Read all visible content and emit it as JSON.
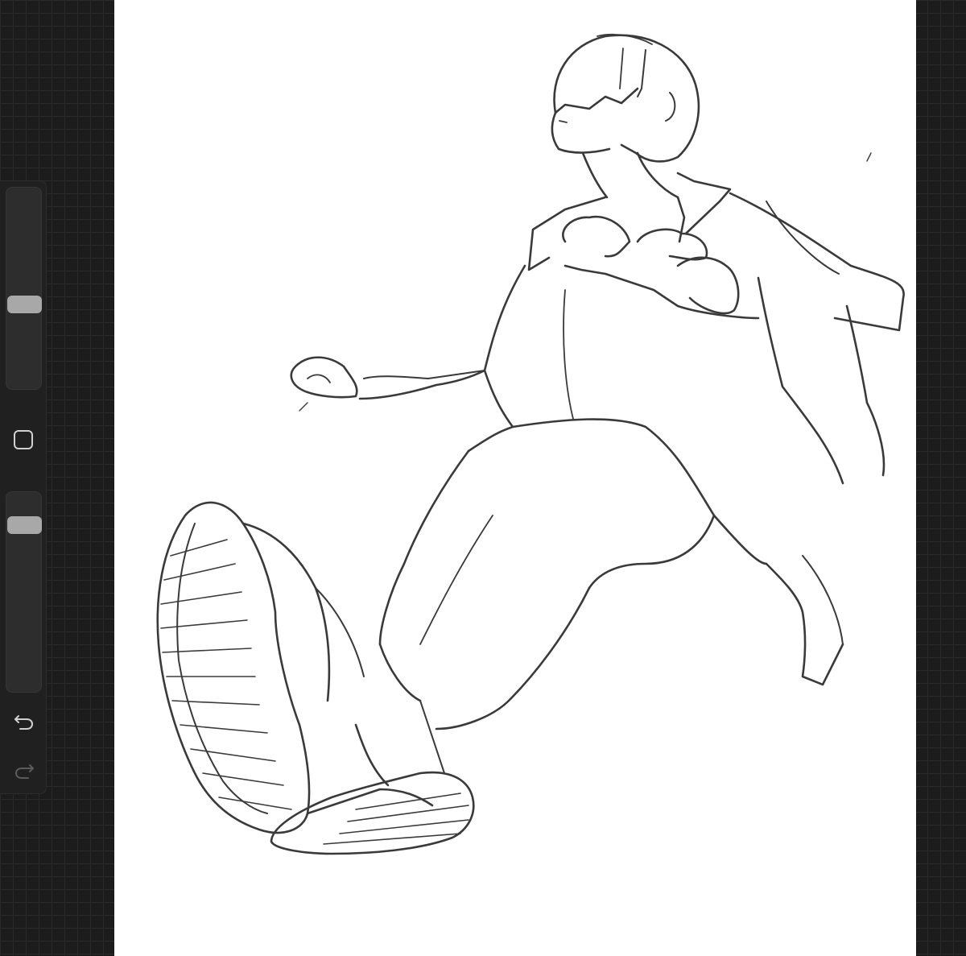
{
  "app": {
    "name": "drawing-canvas"
  },
  "sidebar": {
    "brush_size_slider": {
      "level": 0.41
    },
    "opacity_slider": {
      "level": 0.87
    },
    "modify_button_icon": "square-outline-icon",
    "undo_icon": "undo-arrow-icon",
    "redo_icon": "redo-arrow-icon",
    "redo_enabled": false
  },
  "canvas": {
    "background": "#ffffff",
    "stroke_color": "#3a3a3a"
  },
  "colors": {
    "workspace_bg": "#1c1c1c",
    "grid_line": "#2a2a2a",
    "sidebar_bg": "#202020",
    "thumb": "#a8a8a8"
  }
}
